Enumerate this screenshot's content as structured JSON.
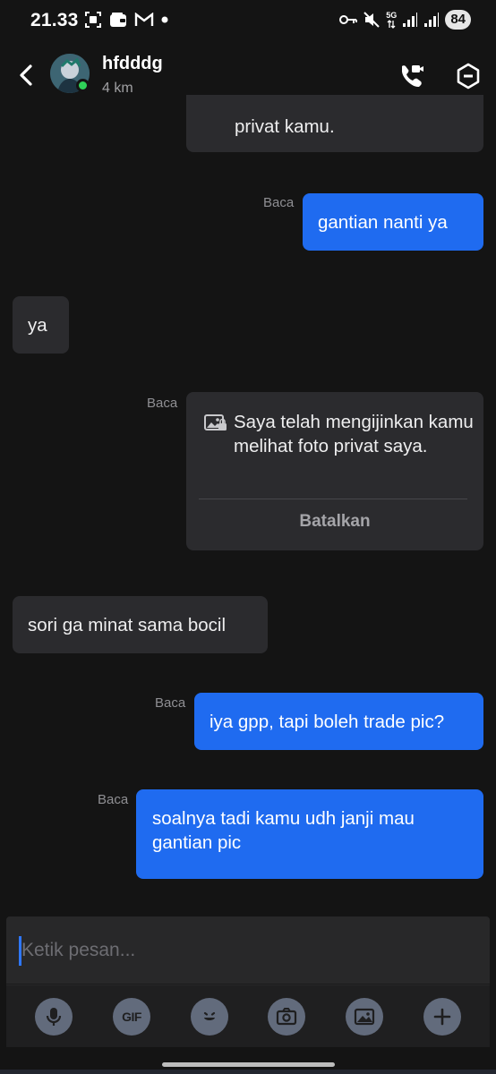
{
  "status_bar": {
    "time": "21.33",
    "network": "5G",
    "battery": "84",
    "icons": [
      "screenshot-icon",
      "wallet-icon",
      "gmail-icon",
      "dot-icon",
      "vpn-key-icon",
      "mute-icon",
      "signal-icon",
      "signal-icon"
    ]
  },
  "header": {
    "contact_name": "hfdddg",
    "distance": "4 km",
    "online": true,
    "icons": [
      "back-arrow-icon",
      "video-call-icon",
      "hexagon-menu-icon"
    ]
  },
  "messages": {
    "top_partial": "privat kamu.",
    "m1": {
      "text": "gantian nanti ya",
      "status": "Baca"
    },
    "m2": {
      "text": "ya"
    },
    "card": {
      "text": "Saya telah mengijinkan kamu melihat foto privat saya.",
      "status": "Baca",
      "cancel_label": "Batalkan",
      "icon": "private-photo-icon"
    },
    "m3": {
      "text": "sori ga minat sama bocil"
    },
    "m4": {
      "text": "iya gpp, tapi boleh trade pic?",
      "status": "Baca"
    },
    "m5": {
      "text": "soalnya tadi kamu udh janji mau gantian pic",
      "status": "Baca"
    }
  },
  "composer": {
    "placeholder": "Ketik pesan...",
    "value": "",
    "gif_label": "GIF",
    "tools": [
      "microphone-icon",
      "gif-icon",
      "emoji-icon",
      "camera-icon",
      "gallery-icon",
      "plus-icon"
    ]
  },
  "colors": {
    "background": "#141414",
    "incoming_bubble": "#2b2b2e",
    "outgoing_bubble": "#1f6bf0",
    "online": "#2fd158",
    "tool_button": "#626b7c"
  }
}
